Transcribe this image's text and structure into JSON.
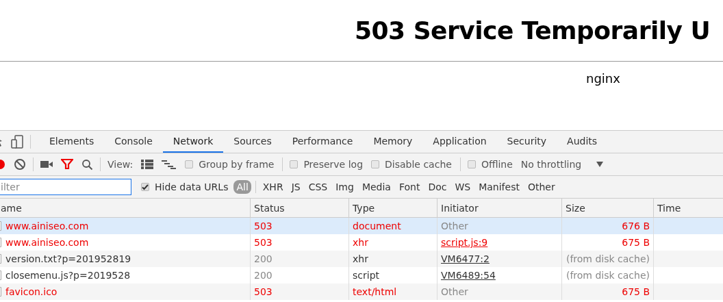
{
  "page": {
    "heading": "503 Service Temporarily U",
    "footer": "nginx"
  },
  "devtools": {
    "tabs": [
      {
        "label": "Elements",
        "selected": false
      },
      {
        "label": "Console",
        "selected": false
      },
      {
        "label": "Network",
        "selected": true
      },
      {
        "label": "Sources",
        "selected": false
      },
      {
        "label": "Performance",
        "selected": false
      },
      {
        "label": "Memory",
        "selected": false
      },
      {
        "label": "Application",
        "selected": false
      },
      {
        "label": "Security",
        "selected": false
      },
      {
        "label": "Audits",
        "selected": false
      }
    ],
    "toolbar": {
      "recording": true,
      "view_label": "View:",
      "options": [
        {
          "label": "Group by frame",
          "checked": false
        },
        {
          "label": "Preserve log",
          "checked": false
        },
        {
          "label": "Disable cache",
          "checked": false
        },
        {
          "label": "Offline",
          "checked": false
        }
      ],
      "throttling": "No throttling"
    },
    "filter": {
      "placeholder": "ilter",
      "hide_data_urls": {
        "label": "Hide data URLs",
        "checked": true
      },
      "types": [
        {
          "label": "All",
          "selected": true
        },
        {
          "label": "XHR",
          "selected": false
        },
        {
          "label": "JS",
          "selected": false
        },
        {
          "label": "CSS",
          "selected": false
        },
        {
          "label": "Img",
          "selected": false
        },
        {
          "label": "Media",
          "selected": false
        },
        {
          "label": "Font",
          "selected": false
        },
        {
          "label": "Doc",
          "selected": false
        },
        {
          "label": "WS",
          "selected": false
        },
        {
          "label": "Manifest",
          "selected": false
        },
        {
          "label": "Other",
          "selected": false
        }
      ]
    },
    "table": {
      "columns": [
        "ame",
        "Status",
        "Type",
        "Initiator",
        "Size",
        "Time"
      ],
      "rows": [
        {
          "name": "www.ainiseo.com",
          "status": "503",
          "type": "document",
          "initiator": "Other",
          "initiator_link": false,
          "size": "676 B",
          "error": true,
          "selected": true
        },
        {
          "name": "www.ainiseo.com",
          "status": "503",
          "type": "xhr",
          "initiator": "script.js:9",
          "initiator_link": true,
          "size": "675 B",
          "error": true,
          "selected": false
        },
        {
          "name": "version.txt?p=201952819",
          "status": "200",
          "type": "xhr",
          "initiator": "VM6477:2",
          "initiator_link": true,
          "size": "(from disk cache)",
          "error": false,
          "selected": false
        },
        {
          "name": "closemenu.js?p=2019528",
          "status": "200",
          "type": "script",
          "initiator": "VM6489:54",
          "initiator_link": true,
          "size": "(from disk cache)",
          "error": false,
          "selected": false
        },
        {
          "name": "favicon.ico",
          "status": "503",
          "type": "text/html",
          "initiator": "Other",
          "initiator_link": false,
          "size": "675 B",
          "error": true,
          "selected": false
        }
      ]
    }
  }
}
